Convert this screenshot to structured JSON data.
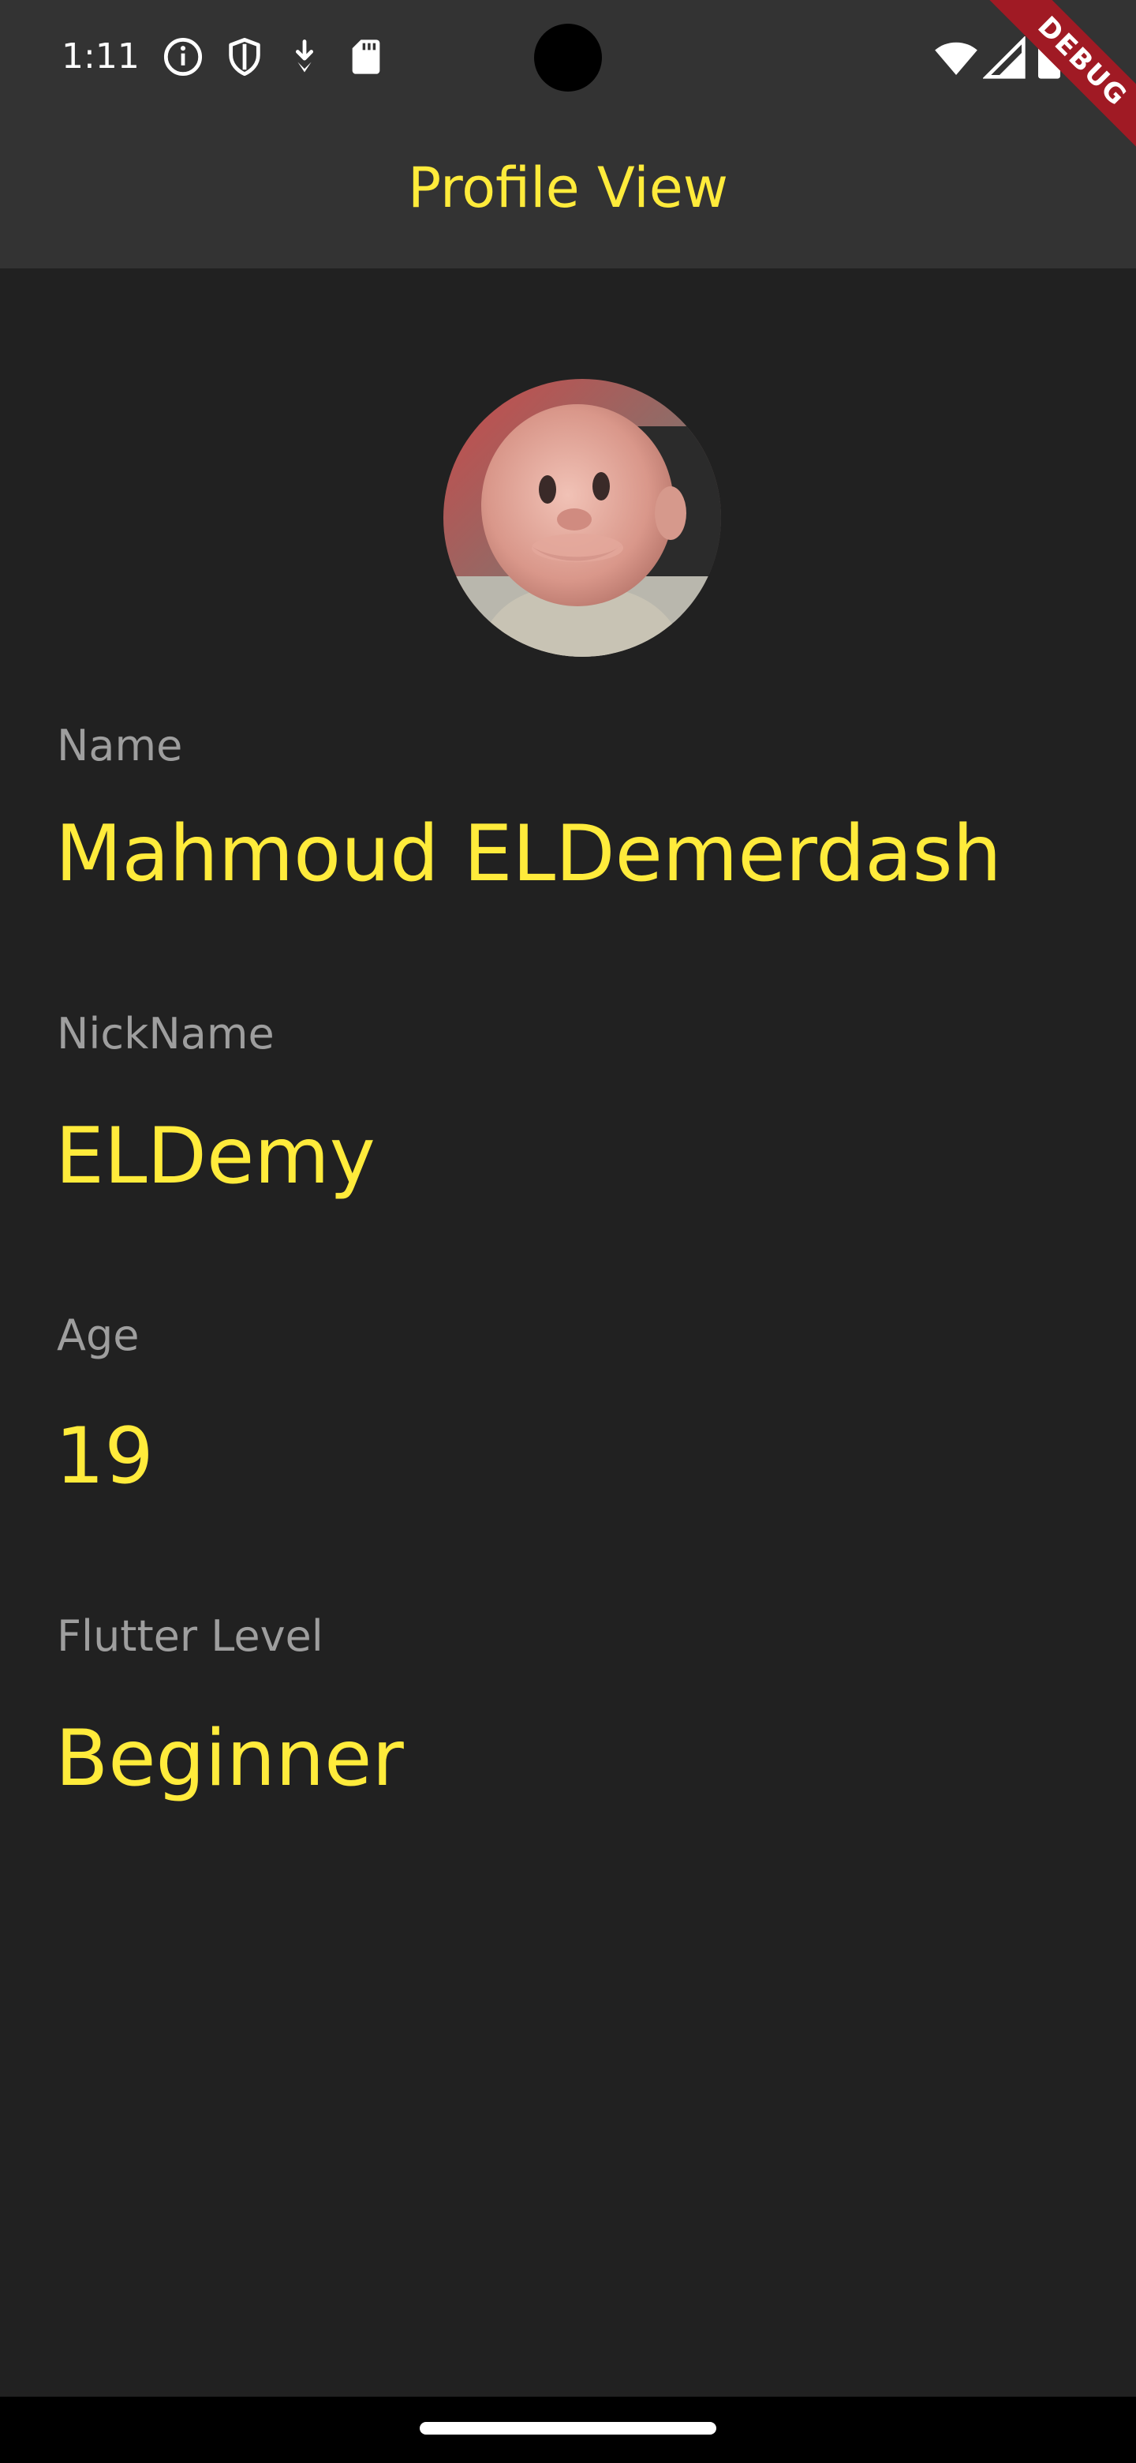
{
  "status_bar": {
    "time": "1:11",
    "left_icons": [
      "info-icon",
      "shield-icon",
      "download-icon",
      "sd-card-icon"
    ],
    "right_icons": [
      "wifi-icon",
      "cell-signal-icon",
      "battery-icon"
    ]
  },
  "app_bar": {
    "title": "Profile View"
  },
  "debug_banner": {
    "label": "DEBUG"
  },
  "profile": {
    "fields": [
      {
        "label": "Name",
        "value": "Mahmoud ELDemerdash"
      },
      {
        "label": "NickName",
        "value": "ELDemy"
      },
      {
        "label": "Age",
        "value": "19"
      },
      {
        "label": "Flutter Level",
        "value": "Beginner"
      }
    ]
  },
  "colors": {
    "accent": "#ffeb3b",
    "background": "#212121",
    "app_bar": "#333333",
    "label": "#9e9e9e",
    "debug": "#a01a24"
  }
}
